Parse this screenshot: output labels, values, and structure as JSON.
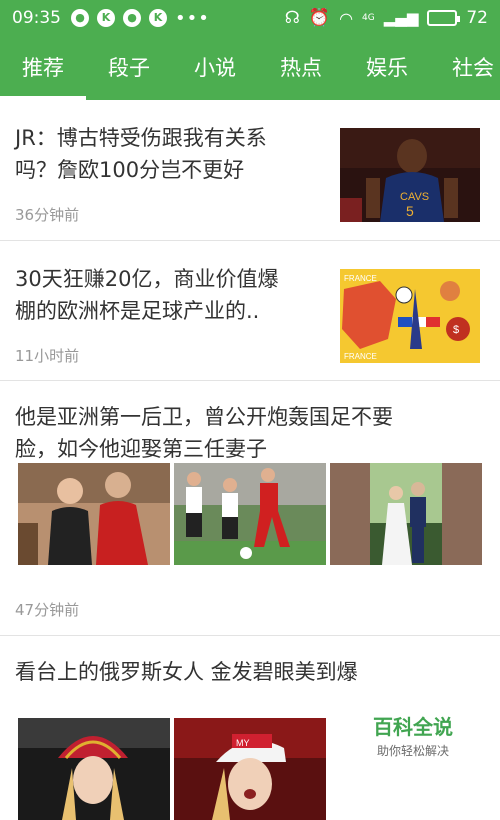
{
  "status": {
    "time": "09:35",
    "battery": "72",
    "icons": [
      "chat-icon",
      "k-icon",
      "message-icon",
      "k-icon",
      "more-icon"
    ],
    "right_icons": [
      "headset-icon",
      "alarm-icon",
      "wifi-icon",
      "signal-icon"
    ],
    "network": "4G"
  },
  "tabs": [
    {
      "label": "推荐",
      "active": true
    },
    {
      "label": "段子"
    },
    {
      "label": "小说"
    },
    {
      "label": "热点"
    },
    {
      "label": "娱乐"
    },
    {
      "label": "社会"
    }
  ],
  "feed": [
    {
      "title_line1": "JR：博古特受伤跟我有关系",
      "title_line2": "吗？詹欧100分岂不更好",
      "time": "36分钟前"
    },
    {
      "title_line1": "30天狂赚20亿，商业价值爆",
      "title_line2": "棚的欧洲杯是足球产业的..",
      "time": "11小时前",
      "thumb_text": "FRANCE"
    },
    {
      "title_line1": "他是亚洲第一后卫，曾公开炮轰国足不要",
      "title_line2": "脸，如今他迎娶第三任妻子",
      "time": "47分钟前"
    },
    {
      "title_line1": "看台上的俄罗斯女人 金发碧眼美到爆"
    }
  ],
  "watermark": {
    "main": "百科全说",
    "sub": "助你轻松解决"
  },
  "colors": {
    "brand": "#4cae50"
  }
}
